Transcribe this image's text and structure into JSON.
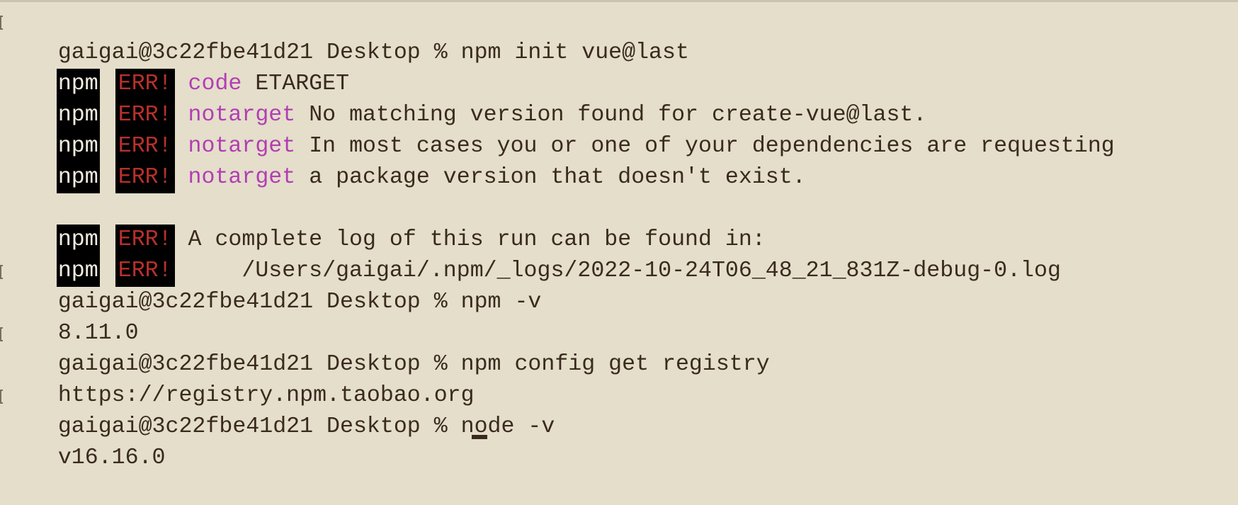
{
  "terminal": {
    "lines": [
      {
        "kind": "prompt",
        "prompt": "gaigai@3c22fbe41d21 Desktop % ",
        "command": "npm init vue@last"
      },
      {
        "kind": "err",
        "npm": "npm",
        "err": "ERR!",
        "code": "code",
        "text": " ETARGET"
      },
      {
        "kind": "err",
        "npm": "npm",
        "err": "ERR!",
        "code": "notarget",
        "text": " No matching version found for create-vue@last."
      },
      {
        "kind": "err",
        "npm": "npm",
        "err": "ERR!",
        "code": "notarget",
        "text": " In most cases you or one of your dependencies are requesting"
      },
      {
        "kind": "err",
        "npm": "npm",
        "err": "ERR!",
        "code": "notarget",
        "text": " a package version that doesn't exist."
      },
      {
        "kind": "blank"
      },
      {
        "kind": "err",
        "npm": "npm",
        "err": "ERR!",
        "code": "",
        "text": "A complete log of this run can be found in:"
      },
      {
        "kind": "err",
        "npm": "npm",
        "err": "ERR!",
        "code": "",
        "text": "    /Users/gaigai/.npm/_logs/2022-10-24T06_48_21_831Z-debug-0.log"
      },
      {
        "kind": "prompt",
        "prompt": "gaigai@3c22fbe41d21 Desktop % ",
        "command": "npm -v"
      },
      {
        "kind": "output",
        "text": "8.11.0"
      },
      {
        "kind": "prompt",
        "prompt": "gaigai@3c22fbe41d21 Desktop % ",
        "command": "npm config get registry"
      },
      {
        "kind": "output",
        "text": "https://registry.npm.taobao.org"
      },
      {
        "kind": "prompt",
        "prompt": "gaigai@3c22fbe41d21 Desktop % ",
        "command": "node -v"
      },
      {
        "kind": "output",
        "text": "v16.16.0"
      }
    ]
  },
  "colors": {
    "background": "#e4decb",
    "text": "#3a2a1e",
    "err_text": "#b8302b",
    "code_text": "#b33db3",
    "tag_background": "#000000"
  }
}
